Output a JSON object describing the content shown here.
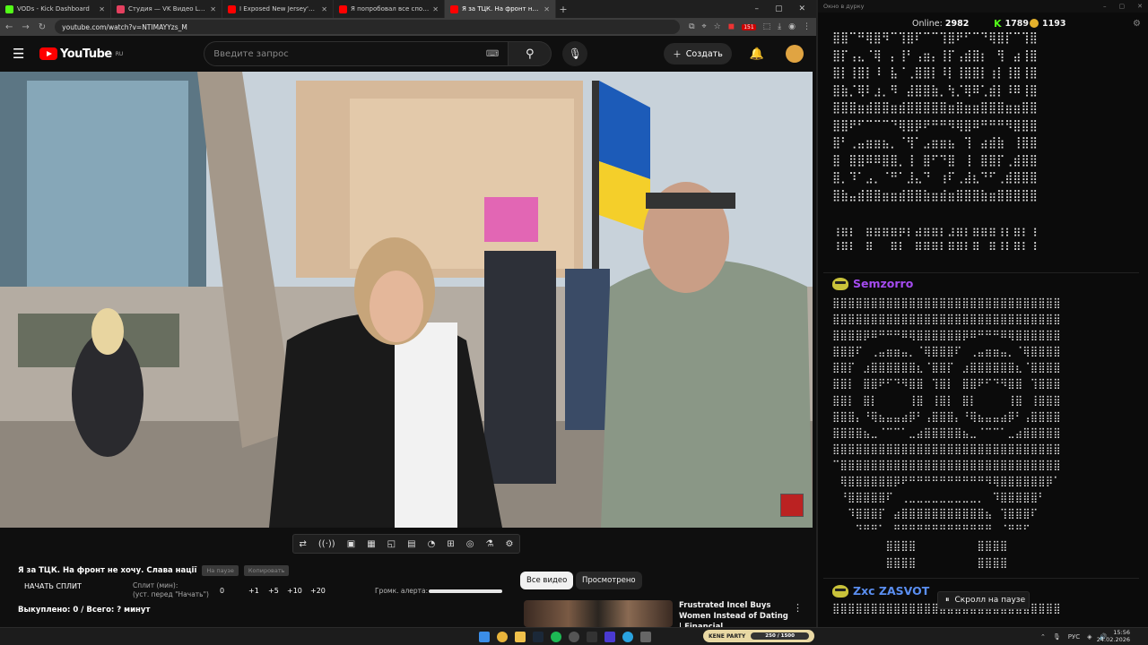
{
  "browser": {
    "tabs": [
      {
        "title": "VODs - Kick Dashboard",
        "color": "#53fc18"
      },
      {
        "title": "Студия — VK Видео Live",
        "color": "#e4405f"
      },
      {
        "title": "I Exposed New Jersey's Jewish",
        "color": "#ff0000"
      },
      {
        "title": "Я попробовал все способы б",
        "color": "#ff0000"
      },
      {
        "title": "Я за ТЦК. На фронт не хочу. С",
        "color": "#ff0000"
      }
    ],
    "new_tab": "+",
    "window_controls": [
      "–",
      "▢",
      "✕"
    ],
    "url": "youtube.com/watch?v=NTIMAYYzs_M",
    "badge_count": "151"
  },
  "youtube": {
    "logo_text": "YouTube",
    "region": "RU",
    "search_placeholder": "Введите запрос",
    "create_label": "Создать"
  },
  "player_toolbar": {
    "icons": [
      "⇄",
      "((·))",
      "▣",
      "▦",
      "◱",
      "▤",
      "◔",
      "⊞",
      "◎",
      "⚗",
      "⚙"
    ]
  },
  "below": {
    "title": "Я за ТЦК. На фронт не хочу. Слава нації",
    "chips": [
      "На паузе",
      "Копировать"
    ],
    "split_start": "НАЧАТЬ СПЛИТ",
    "split_label_1": "Сплит (мин):",
    "split_label_2": "(уст. перед \"Начать\")",
    "split_value": "0",
    "increments": [
      "+1",
      "+5",
      "+10",
      "+20"
    ],
    "alert_label": "Громк. алерта:",
    "alert_volume": 1.0,
    "bought": "Выкуплено: 0 / Всего: ? минут",
    "filters": {
      "all": "Все видео",
      "watched": "Просмотрено"
    },
    "recommendation": {
      "title": "Frustrated Incel Buys Women Instead of Dating | Financial ..."
    }
  },
  "chat": {
    "window_title": "Окно в дурку",
    "online_label": "Online:",
    "online_value": "2982",
    "kick_count": "1789",
    "gold_count": "1193",
    "messages": [
      {
        "user": "",
        "user_color": "#ffffff",
        "art": [
          "⣿⣿⠉⠛⢿⣿⠻⠉⢹⣿⠏⠉⠉⢹⣿⠟⠋⠉⠙⢿⣿⡏⠉⢹⣿",
          "⣿⡏⢠⣄⠈⢿⠀⡄⢸⠃⢠⣶⡄⢸⡏⢠⣾⣿⡆⠀⢻⠀⣴⢸⣿",
          "⣿⡇⢸⣿⡇⠸⠀⣧⠈⢀⣿⣿⡇⠸⡇⢸⣿⣿⡇⢰⡇⢸⣿⢸⣿",
          "⣿⣷⡈⢿⠇⣰⡀⠻⠀⣼⣿⣿⣷⡀⢳⡈⢿⠿⢁⣾⡇⠸⠿⢸⣿",
          "⣿⣿⣿⣶⣾⣿⣿⣶⣾⣿⣿⣿⣿⣿⣶⣿⣶⣶⣿⣿⣿⣶⣶⣿⣿",
          "⣿⣿⠟⠋⠉⠉⠉⠙⢿⣿⡿⠟⠛⠛⠻⢿⣿⠿⠛⠛⠛⠻⣿⣿⣿",
          "⣿⠃⢀⣤⣶⣶⣦⡀⠈⢻⠁⣠⣶⣶⣦⠀⢹⠀⣴⣾⣷⠀⢸⣿⣿",
          "⣿⠀⣿⣿⠿⠿⣿⣿⡀⢸⠀⣿⠋⠙⣿⠀⢸⠀⣿⣿⡏⢀⣾⣿⣿",
          "⣿⡀⠹⠁⣠⡀⠈⠛⠁⣸⣄⠙⠀⢰⠏⢀⣼⣆⠙⠋⢀⣾⣿⣿⣿",
          "⣿⣷⣤⣾⣿⣿⣶⣶⣾⣿⣿⣷⣶⣾⣶⣿⣿⣿⣷⣶⣿⣿⣿⣿⣿",
          "⠀⠀⠀⠀⠀⠀⠀⠀⠀⠀⠀⠀⠀⠀⠀⠀⠀⠀⠀⠀⠀⠀⠀⠀⠀",
          "⢰⣶⡆⠀⣶⣶⣶⣶⡶⡆⣴⣶⣶⡆⣰⣶⡆⣶⣶⣶⢰⡆⣶⡆⢰",
          "⠸⠿⠇⠀⠿⠀⠀⠿⠇⠀⠿⠿⠿⠇⠿⠿⠇⠿⠀⠿⠸⠇⠿⠇⠸"
        ]
      },
      {
        "user": "Semzorro",
        "user_color": "#a44bf0",
        "art": [
          "⣿⣿⣿⣿⣿⣿⣿⣿⣿⣿⣿⣿⣿⣿⣿⣿⣿⣿⣿⣿⣿⣿⣿⣿⣿⣿⣿⣿⣿⣿",
          "⣿⣿⣿⣿⣿⣿⣿⣿⣿⣿⣿⣿⣿⣿⣿⣿⣿⣿⣿⣿⣿⣿⣿⣿⣿⣿⣿⣿⣿⣿",
          "⣿⣿⣿⣿⡿⠿⠛⠛⠛⠿⢿⣿⣿⣿⣿⣿⣿⡿⠿⠛⠛⠛⠿⢿⣿⣿⣿⣿⣿⣿",
          "⣿⣿⣿⠏⠀⢀⣤⣶⣶⣤⡀⠈⢿⣿⣿⣿⠏⠀⢀⣤⣶⣶⣤⡀⠈⢿⣿⣿⣿⣿",
          "⣿⣿⡏⠀⣰⣿⣿⣿⣿⣿⣿⣆⠈⣿⣿⡏⠀⣰⣿⣿⣿⣿⣿⣿⣆⠈⣿⣿⣿⣿",
          "⣿⣿⡇⠀⣿⣿⠟⠋⠙⠻⣿⣿⠀⢹⣿⡇⠀⣿⣿⠟⠋⠙⠻⣿⣿⠀⢹⣿⣿⣿",
          "⣿⣿⡇⠀⣿⡇⠀⠀⠀⠀⢸⣿⠀⢸⣿⡇⠀⣿⡇⠀⠀⠀⠀⢸⣿⠀⢸⣿⣿⣿",
          "⣿⣿⣿⡄⠘⢿⣦⣤⣤⣴⡿⠃⢠⣿⣿⣿⡄⠘⢿⣦⣤⣤⣴⡿⠃⢠⣿⣿⣿⣿",
          "⣿⣿⣿⣿⣦⣀⠈⠉⠉⠁⣀⣴⣿⣿⣿⣿⣿⣦⣀⠈⠉⠉⠁⣀⣴⣿⣿⣿⣿⣿",
          "⣿⣿⣿⣿⣿⣿⣿⣿⣿⣿⣿⣿⣿⣿⣿⣿⣿⣿⣿⣿⣿⣿⣿⣿⣿⣿⣿⣿⣿⣿",
          "⠉⣿⣿⣿⣿⣿⣿⣿⣿⣿⣿⣿⣿⣿⣿⣿⣿⣿⣿⣿⣿⣿⣿⣿⣿⣿⣿⣿⣿⣿",
          "⠀⢿⣿⣿⣿⣿⣿⣿⡿⠟⠛⠛⠛⠛⠛⠛⠛⠛⠛⠛⠻⢿⣿⣿⣿⣿⣿⣿⡿⠁",
          "⠀⠘⣿⣿⣿⣿⣿⠏⠀⢀⣀⣀⣀⣀⣀⣀⣀⣀⣀⡀⠀⠹⣿⣿⣿⣿⣿⠃⠀⠀",
          "⠀⠀⠹⣿⣿⣿⡏⠀⣴⣿⣿⣿⣿⣿⣿⣿⣿⣿⣿⣿⣦⠀⢹⣿⣿⣿⠏⠀⠀⠀",
          "⠀⠀⠀⠙⠛⠛⠁⠀⠛⠛⠛⠛⠛⠛⠛⠛⠛⠛⠛⠛⠛⠀⠈⠛⠛⠋⠀⠀⠀⠀",
          "⠀⠀⠀⠀⠀⠀⠀⣿⣿⣿⣿⠀⠀⠀⠀⠀⠀⠀⠀⣿⣿⣿⣿⠀⠀⠀⠀⠀⠀⠀",
          "⠀⠀⠀⠀⠀⠀⠀⣿⣿⣿⣿⠀⠀⠀⠀⠀⠀⠀⠀⣿⣿⣿⣿⠀⠀⠀⠀⠀⠀⠀"
        ]
      },
      {
        "user": "Zxc ZASVOT",
        "user_color": "#5a8ef0",
        "art": [
          "⣿⣿⣿⣿⣿⣿⣿⣿⣿⣿⣿⣿⣿⣿⣿⣿⣿⣿⣿⣿⣿⣿⣿⣿⣿⣿⣿⣿⣿⣿"
        ]
      }
    ],
    "pause_label": "Скролл на паузе"
  },
  "taskbar": {
    "overlay_name": "KENE PARTY",
    "overlay_progress": "250 / 1500",
    "lang": "РУС",
    "time": "15:56",
    "date": "24.02.2026"
  }
}
